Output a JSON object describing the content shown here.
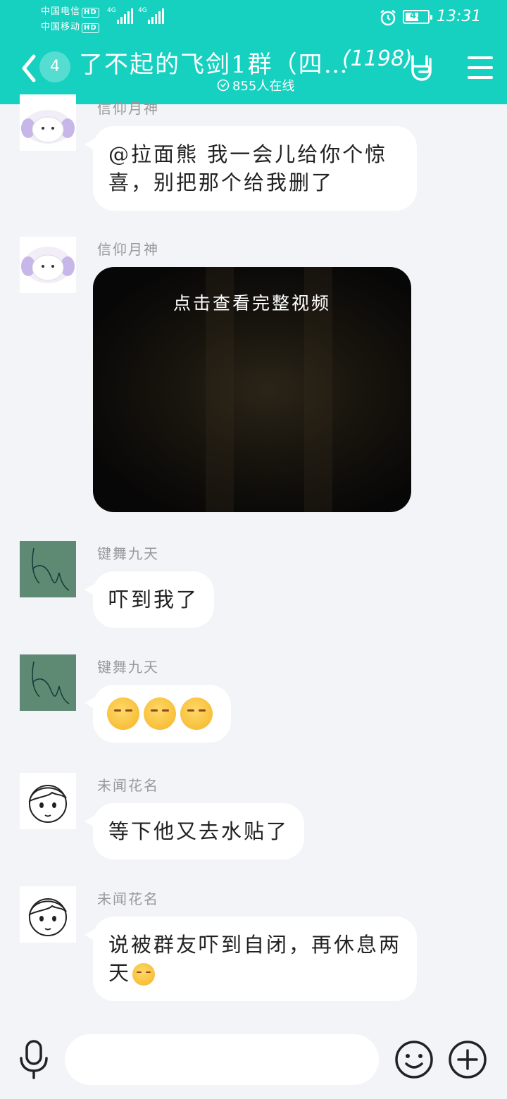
{
  "status": {
    "carrier1": "中国电信",
    "carrier2": "中国移动",
    "hd": "HD",
    "net": "4G",
    "battery_level": "41",
    "time": "13:31"
  },
  "header": {
    "unread_badge": "4",
    "title": "了不起的飞剑1群（四…",
    "member_count": "(1198)",
    "online": "855人在线"
  },
  "messages": [
    {
      "sender": "信仰月神",
      "text": "@拉面熊 我一会儿给你个惊喜，别把那个给我删了"
    },
    {
      "sender": "信仰月神",
      "video_label": "点击查看完整视频"
    },
    {
      "sender": "键舞九天",
      "text": "吓到我了"
    },
    {
      "sender": "键舞九天",
      "emoji_count": 3
    },
    {
      "sender": "未闻花名",
      "text": "等下他又去水贴了"
    },
    {
      "sender": "未闻花名",
      "text": "说被群友吓到自闭，再休息两天"
    }
  ],
  "input": {
    "placeholder": ""
  },
  "colors": {
    "accent": "#16d0c0",
    "background": "#f3f4f8"
  }
}
